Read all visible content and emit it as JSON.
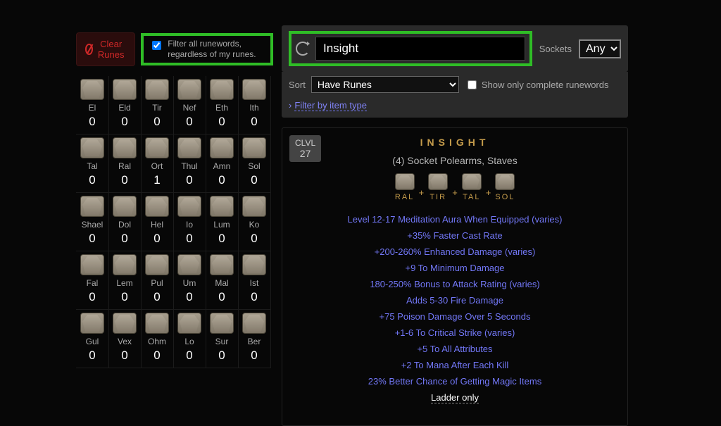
{
  "clear_button_label": "Clear Runes",
  "filter_all_label": "Filter all runewords, regardless of my runes.",
  "filter_all_checked": true,
  "runes": [
    {
      "name": "El",
      "count": 0
    },
    {
      "name": "Eld",
      "count": 0
    },
    {
      "name": "Tir",
      "count": 0
    },
    {
      "name": "Nef",
      "count": 0
    },
    {
      "name": "Eth",
      "count": 0
    },
    {
      "name": "Ith",
      "count": 0
    },
    {
      "name": "Tal",
      "count": 0
    },
    {
      "name": "Ral",
      "count": 0
    },
    {
      "name": "Ort",
      "count": 1
    },
    {
      "name": "Thul",
      "count": 0
    },
    {
      "name": "Amn",
      "count": 0
    },
    {
      "name": "Sol",
      "count": 0
    },
    {
      "name": "Shael",
      "count": 0
    },
    {
      "name": "Dol",
      "count": 0
    },
    {
      "name": "Hel",
      "count": 0
    },
    {
      "name": "Io",
      "count": 0
    },
    {
      "name": "Lum",
      "count": 0
    },
    {
      "name": "Ko",
      "count": 0
    },
    {
      "name": "Fal",
      "count": 0
    },
    {
      "name": "Lem",
      "count": 0
    },
    {
      "name": "Pul",
      "count": 0
    },
    {
      "name": "Um",
      "count": 0
    },
    {
      "name": "Mal",
      "count": 0
    },
    {
      "name": "Ist",
      "count": 0
    },
    {
      "name": "Gul",
      "count": 0
    },
    {
      "name": "Vex",
      "count": 0
    },
    {
      "name": "Ohm",
      "count": 0
    },
    {
      "name": "Lo",
      "count": 0
    },
    {
      "name": "Sur",
      "count": 0
    },
    {
      "name": "Ber",
      "count": 0
    }
  ],
  "search_value": "Insight",
  "sockets_label": "Sockets",
  "sockets_value": "Any",
  "sort_label": "Sort",
  "sort_value": "Have Runes",
  "show_complete_label": "Show only complete runewords",
  "filter_item_label": "Filter by item type",
  "result": {
    "clvl_label": "CLVL",
    "clvl_value": "27",
    "name": "INSIGHT",
    "base": "(4) Socket Polearms, Staves",
    "runes": [
      "RAL",
      "TIR",
      "TAL",
      "SOL"
    ],
    "mods": [
      "Level 12-17 Meditation Aura When Equipped (varies)",
      "+35% Faster Cast Rate",
      "+200-260% Enhanced Damage (varies)",
      "+9 To Minimum Damage",
      "180-250% Bonus to Attack Rating (varies)",
      "Adds 5-30 Fire Damage",
      "+75 Poison Damage Over 5 Seconds",
      "+1-6 To Critical Strike (varies)",
      "+5 To All Attributes",
      "+2 To Mana After Each Kill",
      "23% Better Chance of Getting Magic Items"
    ],
    "ladder_label": "Ladder only"
  }
}
